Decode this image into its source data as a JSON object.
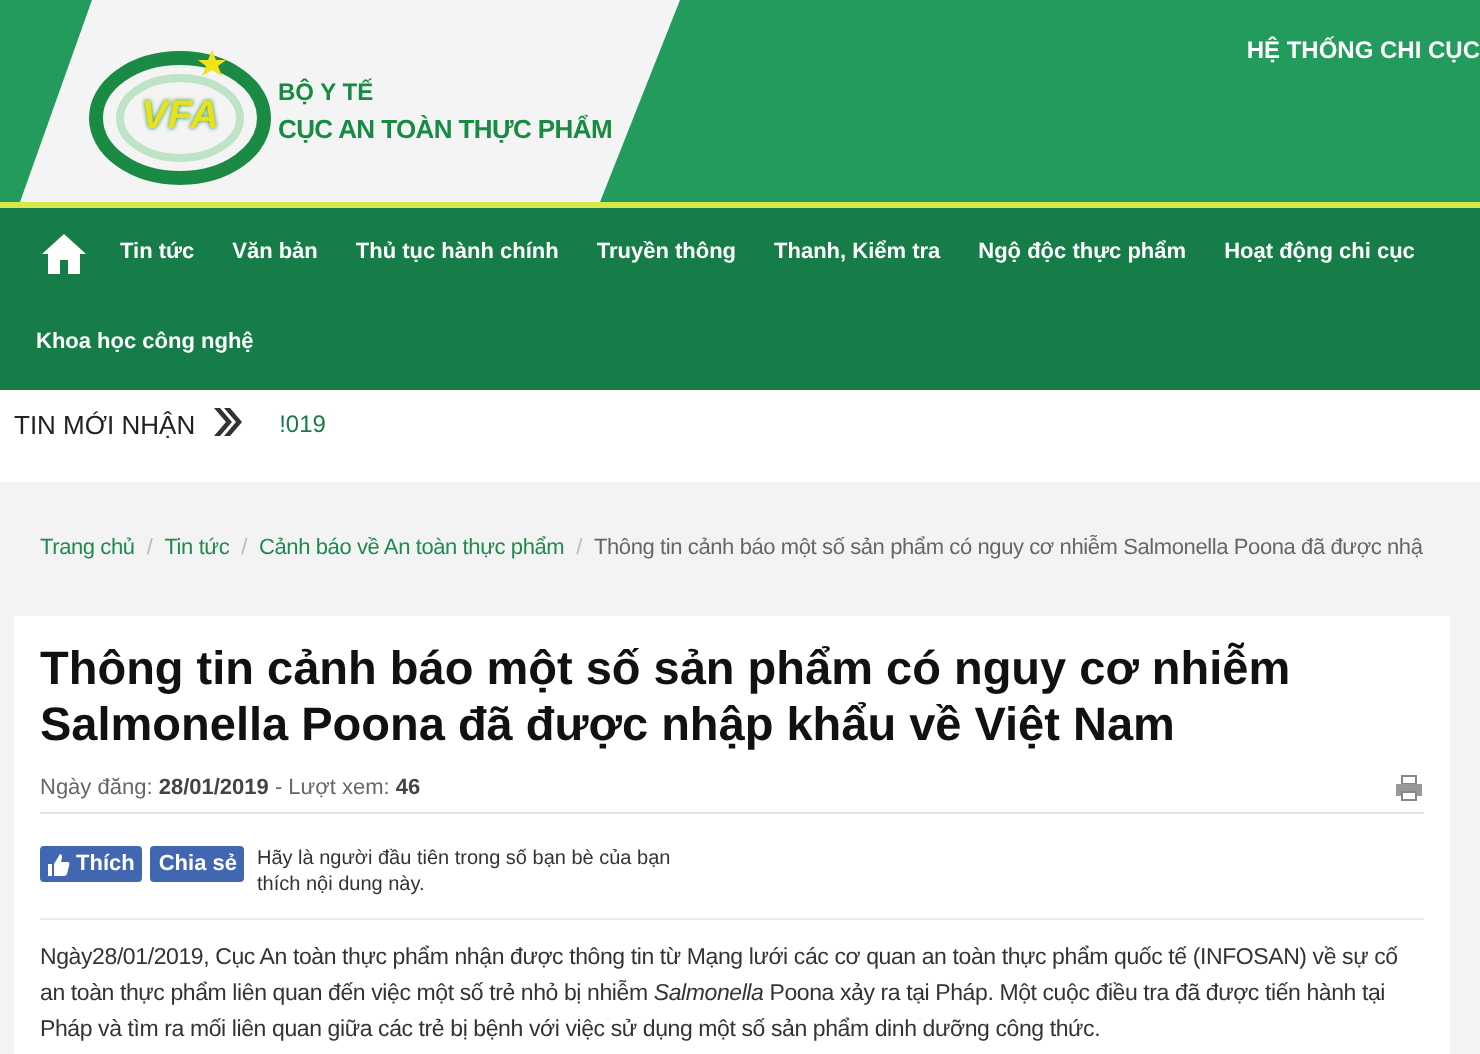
{
  "header": {
    "logo_mark": "VFA",
    "ministry": "BỘ Y TẾ",
    "agency": "CỤC AN TOÀN THỰC PHẨM",
    "top_link": "HỆ THỐNG CHI CỤC"
  },
  "nav": {
    "items": [
      {
        "label": "Tin tức"
      },
      {
        "label": "Văn bản"
      },
      {
        "label": "Thủ tục hành chính"
      },
      {
        "label": "Truyền thông"
      },
      {
        "label": "Thanh, Kiểm tra"
      },
      {
        "label": "Ngộ độc thực phẩm"
      },
      {
        "label": "Hoạt động chi cục"
      },
      {
        "label": "Khoa học công nghệ"
      }
    ]
  },
  "ticker": {
    "label": "TIN MỚI NHẬN",
    "text": "!019"
  },
  "breadcrumb": [
    {
      "label": "Trang chủ",
      "kind": "link"
    },
    {
      "label": "Tin tức",
      "kind": "link"
    },
    {
      "label": "Cảnh báo về An toàn thực phẩm",
      "kind": "link"
    },
    {
      "label": "Thông tin cảnh báo một số sản phẩm có nguy cơ nhiễm Salmonella Poona đã được nhậ",
      "kind": "current"
    }
  ],
  "breadcrumb_separator": "/",
  "article": {
    "title": "Thông tin cảnh báo một số sản phẩm có nguy cơ nhiễm Salmonella Poona đã được nhập khẩu về Việt Nam",
    "date_label": "Ngày đăng:",
    "date": "28/01/2019",
    "views_label": "- Lượt xem:",
    "views": "46",
    "like_button": "Thích",
    "share_button": "Chia sẻ",
    "social_text": "Hãy là người đầu tiên trong số bạn bè của bạn thích nội dung này.",
    "body": "Ngày28/01/2019, Cục An toàn thực phẩm nhận được thông tin từ Mạng lưới các cơ quan an toàn thực phẩm quốc tế (INFOSAN) về sự cố an toàn thực phẩm liên quan đến việc một số trẻ nhỏ bị nhiễm *Salmonella* Poona xảy ra tại Pháp. Một cuộc điều tra đã được tiến hành tại Pháp và tìm ra mối liên quan giữa các trẻ bị bệnh với việc sử dụng một số sản phẩm dinh dưỡng công thức."
  }
}
